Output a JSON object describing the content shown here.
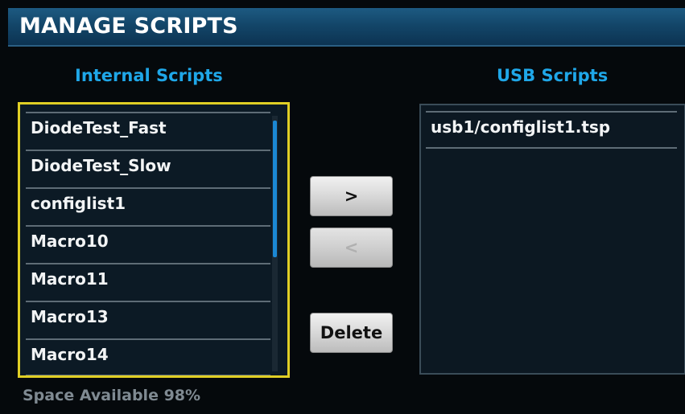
{
  "header": {
    "title": "MANAGE SCRIPTS"
  },
  "internal": {
    "title": "Internal Scripts",
    "items": [
      {
        "label": "DiodeTest_Fast"
      },
      {
        "label": "DiodeTest_Slow"
      },
      {
        "label": "configlist1"
      },
      {
        "label": "Macro10"
      },
      {
        "label": "Macro11"
      },
      {
        "label": "Macro13"
      },
      {
        "label": "Macro14"
      }
    ]
  },
  "usb": {
    "title": "USB Scripts",
    "items": [
      {
        "label": "usb1/configlist1.tsp"
      }
    ]
  },
  "buttons": {
    "copy_to_usb": ">",
    "copy_to_internal": "<",
    "delete": "Delete"
  },
  "footer": {
    "space_available": "Space Available  98%"
  },
  "colors": {
    "title_bar": "#134669",
    "section_title": "#1fa7e8",
    "selection_border": "#e0cf25",
    "scroll_thumb": "#1b88d4"
  }
}
